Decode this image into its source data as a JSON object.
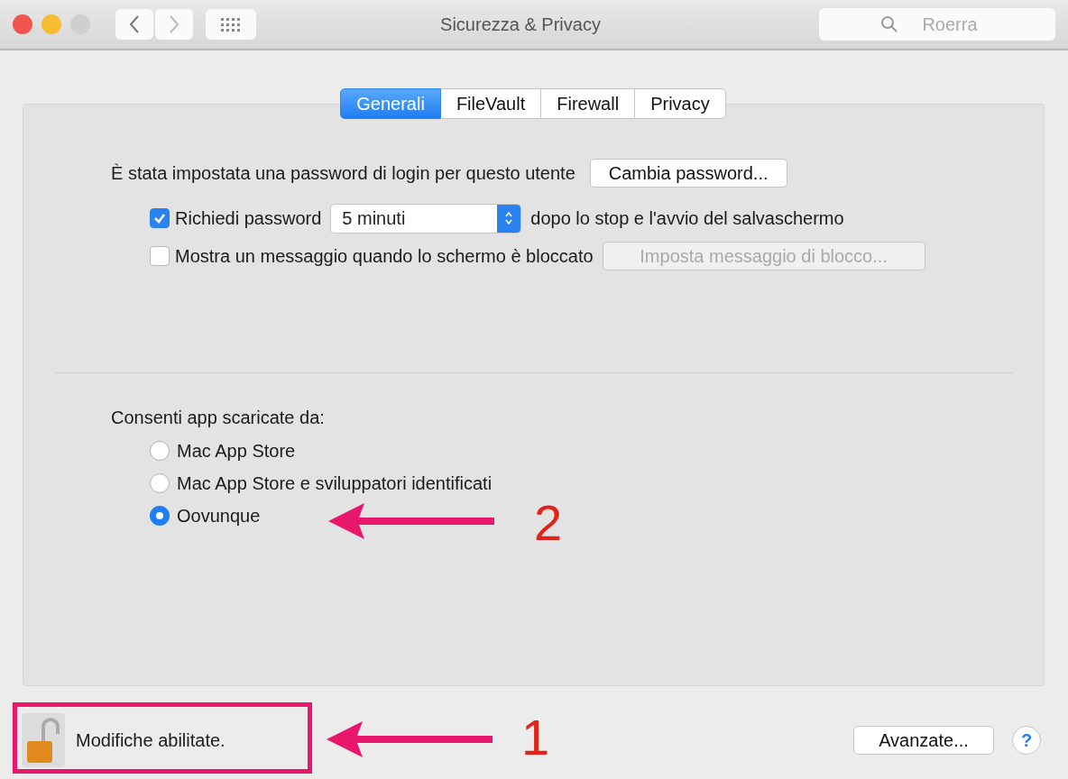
{
  "window": {
    "title": "Sicurezza & Privacy",
    "search": {
      "placeholder": "Roerra"
    }
  },
  "tabs": [
    {
      "label": "Generali",
      "selected": true
    },
    {
      "label": "FileVault",
      "selected": false
    },
    {
      "label": "Firewall",
      "selected": false
    },
    {
      "label": "Privacy",
      "selected": false
    }
  ],
  "login": {
    "text": "È stata impostata una password di login per questo utente",
    "button": "Cambia password..."
  },
  "require_password": {
    "checked": true,
    "label": "Richiedi password",
    "value": "5 minuti",
    "suffix": "dopo lo stop e l'avvio del salvaschermo"
  },
  "lock_message": {
    "checked": false,
    "label": "Mostra un messaggio quando lo schermo è bloccato",
    "button": "Imposta messaggio di blocco...",
    "button_disabled": true
  },
  "allow_apps": {
    "label": "Consenti app scaricate da:",
    "options": [
      {
        "label": "Mac App Store",
        "selected": false
      },
      {
        "label": "Mac App Store e sviluppatori identificati",
        "selected": false
      },
      {
        "label": "Oovunque",
        "selected": true
      }
    ]
  },
  "footer": {
    "lock_text": "Modifiche abilitate.",
    "locked": false,
    "advanced_button": "Avanzate...",
    "help": "?"
  },
  "annotations": [
    {
      "highlight": false,
      "number": "2"
    },
    {
      "highlight": true,
      "number": "1"
    }
  ]
}
